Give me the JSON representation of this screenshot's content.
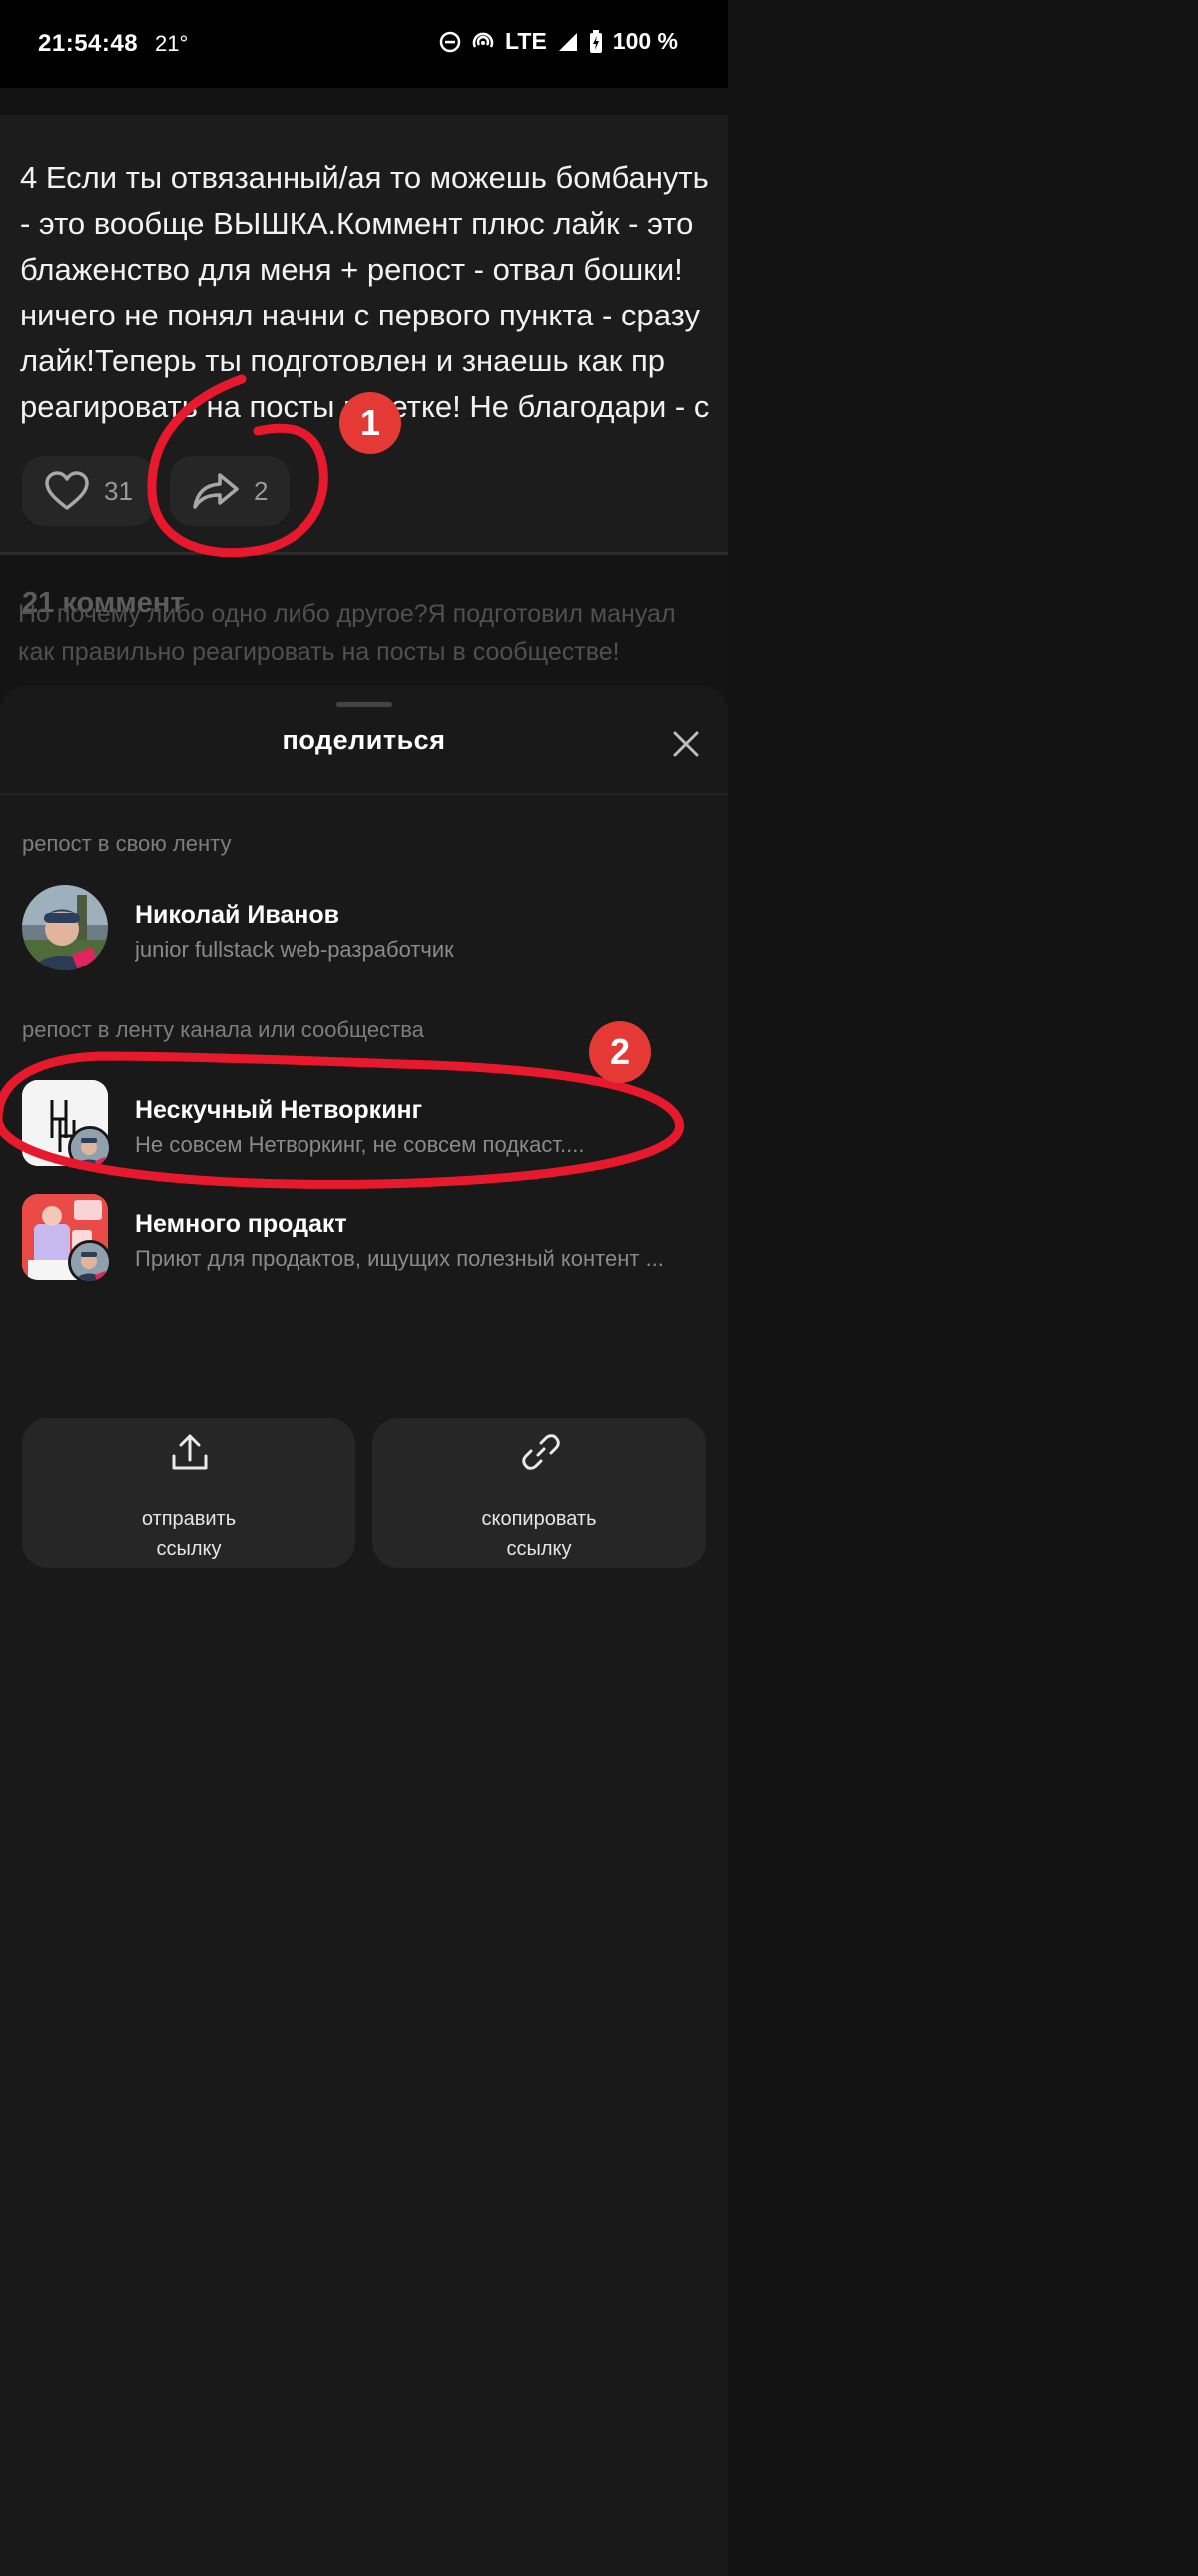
{
  "status_bar": {
    "time": "21:54:48",
    "temperature": "21°",
    "network": "LTE",
    "battery": "100 %"
  },
  "post": {
    "lines": [
      "4 Если ты отвязанный/ая то можешь бомбануть",
      "- это вообще ВЫШКА.⁠⁠Коммент плюс лайк - это",
      "блаженство для меня + репост - отвал бошки!⁠",
      "ничего не понял начни с первого пункта - сразу",
      "лайк!⁠⁠Теперь ты подготовлен и знаешь как пр",
      "реагировать на посты в Сетке! Не благодари - с"
    ],
    "likes": "31",
    "reposts": "2"
  },
  "comments": {
    "count_label": "21 коммент",
    "preview": "Но почему либо одно либо другое?⁠⁠Я подготовил мануал как правильно реагировать на посты в сообществе!"
  },
  "share_sheet": {
    "title": "поделиться",
    "section_own": "репост в свою ленту",
    "user": {
      "name": "Николай Иванов",
      "subtitle": "junior fullstack web-разработчик"
    },
    "section_channel": "репост в ленту канала или сообщества",
    "channels": [
      {
        "name": "Нескучный Нетворкинг",
        "subtitle": "Не совсем Нетворкинг, не совсем подкаст...."
      },
      {
        "name": "Немного продакт",
        "subtitle": "Приют для продактов, ищущих полезный контент ..."
      }
    ],
    "send_link": "отправить\nссылку",
    "copy_link": "скопировать\nссылку"
  },
  "annotations": {
    "badge_1": "1",
    "badge_2": "2",
    "color": "#e8192c"
  }
}
